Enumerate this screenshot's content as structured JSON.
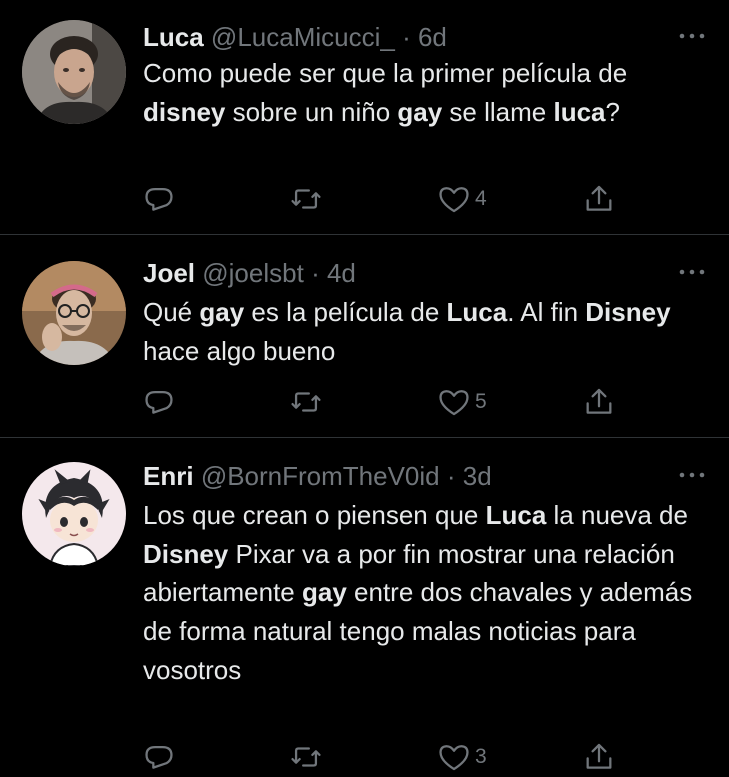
{
  "tweets": [
    {
      "name": "Luca",
      "handle": "@LucaMicucci_",
      "separator": "·",
      "time": "6d",
      "text": [
        {
          "t": "Como puede ser que la primer película de "
        },
        {
          "t": "disney",
          "b": true
        },
        {
          "t": " sobre un niño "
        },
        {
          "t": "gay",
          "b": true
        },
        {
          "t": " se llame "
        },
        {
          "t": "luca",
          "b": true
        },
        {
          "t": "?"
        }
      ],
      "likes": "4",
      "avatar": "photo-man-dark-hair"
    },
    {
      "name": "Joel",
      "handle": "@joelsbt",
      "separator": "·",
      "time": "4d",
      "text": [
        {
          "t": "Qué "
        },
        {
          "t": "gay",
          "b": true
        },
        {
          "t": " es la película de "
        },
        {
          "t": "Luca",
          "b": true
        },
        {
          "t": ". Al fin "
        },
        {
          "t": "Disney",
          "b": true
        },
        {
          "t": " hace algo bueno"
        }
      ],
      "likes": "5",
      "avatar": "photo-man-glasses-headband"
    },
    {
      "name": "Enri",
      "handle": "@BornFromTheV0id",
      "separator": "·",
      "time": "3d",
      "text": [
        {
          "t": "Los que crean o piensen que "
        },
        {
          "t": "Luca",
          "b": true
        },
        {
          "t": " la nueva de "
        },
        {
          "t": "Disney",
          "b": true
        },
        {
          "t": " Pixar va a por fin mostrar una relación abiertamente "
        },
        {
          "t": "gay",
          "b": true
        },
        {
          "t": " entre dos chavales y además de forma natural tengo malas noticias para vosotros"
        }
      ],
      "likes": "3",
      "avatar": "cartoon-boy-avatar"
    }
  ],
  "icons": {
    "reply": "reply-icon",
    "retweet": "retweet-icon",
    "like": "heart-icon",
    "share": "share-icon",
    "more": "more-icon"
  },
  "colors": {
    "background": "#000000",
    "text": "#e7e9ea",
    "secondary": "#71767b",
    "divider": "#2f3336"
  }
}
